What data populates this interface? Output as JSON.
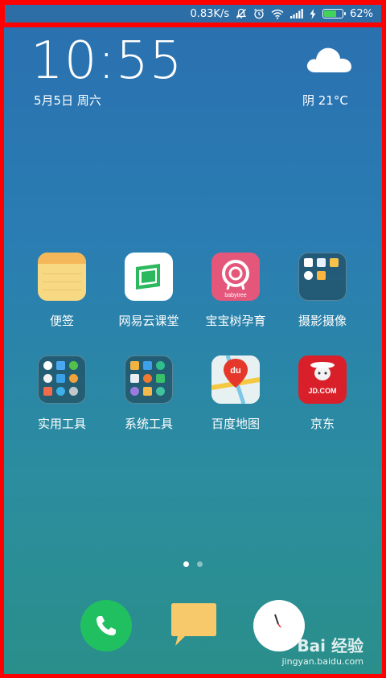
{
  "status_bar": {
    "network_speed": "0.83K/s",
    "battery_percent": "62%",
    "battery_level": 0.62
  },
  "lockscreen": {
    "time": "10:55",
    "date": "5月5日 周六",
    "weather": "阴  21°C"
  },
  "apps": [
    {
      "label": "便签",
      "icon": "notes-icon"
    },
    {
      "label": "网易云课堂",
      "icon": "netease-course-icon"
    },
    {
      "label": "宝宝树孕育",
      "icon": "babytree-icon"
    },
    {
      "label": "摄影摄像",
      "icon": "photo-folder-icon"
    },
    {
      "label": "实用工具",
      "icon": "tools-folder-icon"
    },
    {
      "label": "系统工具",
      "icon": "system-tools-folder-icon"
    },
    {
      "label": "百度地图",
      "icon": "baidu-map-icon"
    },
    {
      "label": "京东",
      "icon": "jd-icon"
    }
  ],
  "icon_text": {
    "babytree": "babytree",
    "map_du": "du",
    "jd": "JD.COM"
  },
  "page_indicator": {
    "pages": 2,
    "current": 1
  },
  "watermark": {
    "main": "Bai 经验",
    "sub": "jingyan.baidu.com"
  },
  "colors": {
    "annotation": "#ff0000",
    "phone_green": "#20c060",
    "battery_green": "#43d35a"
  }
}
